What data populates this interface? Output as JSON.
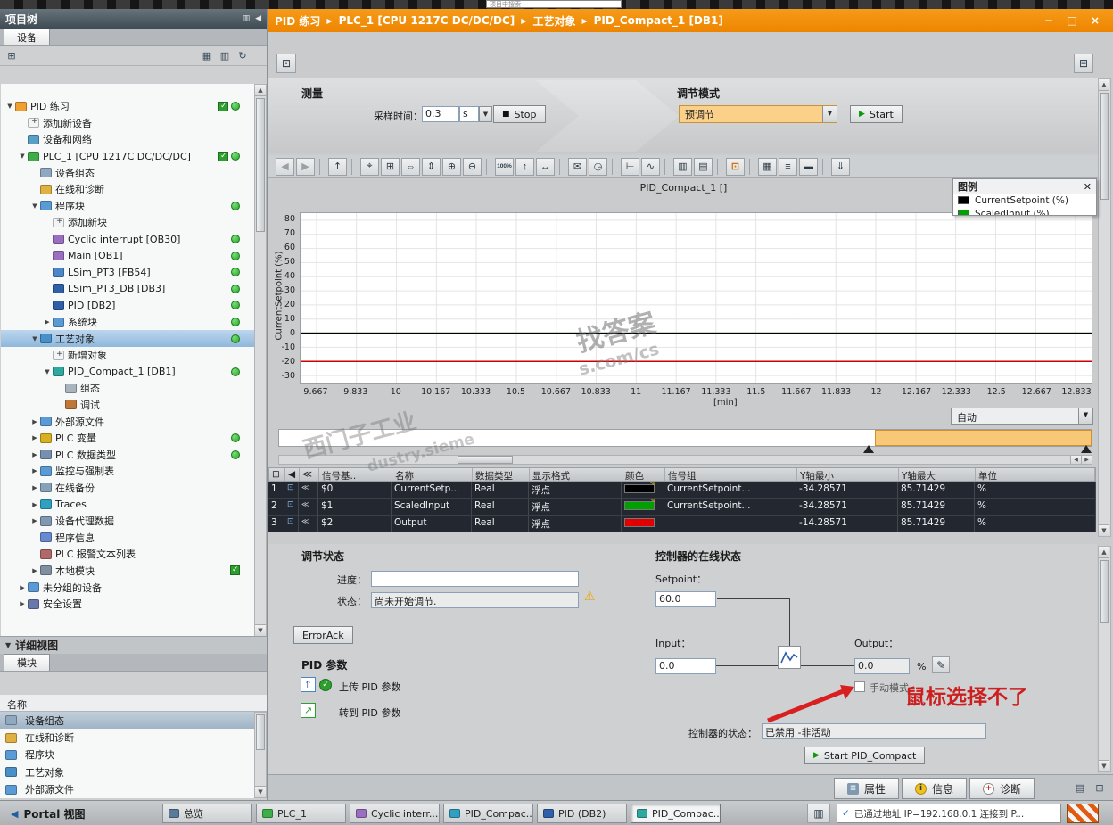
{
  "top_bar": {
    "search_text": "项目中搜索"
  },
  "window": {
    "breadcrumb": [
      "PID 练习",
      "PLC_1 [CPU 1217C DC/DC/DC]",
      "工艺对象",
      "PID_Compact_1 [DB1]"
    ]
  },
  "project_tree": {
    "title": "项目树",
    "tab": "设备",
    "items": [
      {
        "label": "PID 练习",
        "level": 0,
        "arrow": "down",
        "icon": "project-icon",
        "status": [
          "check",
          "dot"
        ]
      },
      {
        "label": "添加新设备",
        "level": 1,
        "icon": "add-device-icon"
      },
      {
        "label": "设备和网络",
        "level": 1,
        "icon": "network-icon"
      },
      {
        "label": "PLC_1 [CPU 1217C DC/DC/DC]",
        "level": 1,
        "arrow": "down",
        "icon": "plc-icon",
        "status": [
          "check",
          "dot"
        ]
      },
      {
        "label": "设备组态",
        "level": 2,
        "icon": "device-config-icon"
      },
      {
        "label": "在线和诊断",
        "level": 2,
        "icon": "online-diag-icon"
      },
      {
        "label": "程序块",
        "level": 2,
        "arrow": "down",
        "icon": "folder-icon",
        "status": [
          "dot"
        ]
      },
      {
        "label": "添加新块",
        "level": 3,
        "icon": "add-block-icon"
      },
      {
        "label": "Cyclic interrupt [OB30]",
        "level": 3,
        "icon": "ob-block-icon",
        "status": [
          "dot"
        ]
      },
      {
        "label": "Main [OB1]",
        "level": 3,
        "icon": "ob-block-icon",
        "status": [
          "dot"
        ]
      },
      {
        "label": "LSim_PT3 [FB54]",
        "level": 3,
        "icon": "fb-block-icon",
        "status": [
          "dot"
        ]
      },
      {
        "label": "LSim_PT3_DB [DB3]",
        "level": 3,
        "icon": "db-block-icon",
        "status": [
          "dot"
        ]
      },
      {
        "label": "PID [DB2]",
        "level": 3,
        "icon": "db-block-icon",
        "status": [
          "dot"
        ]
      },
      {
        "label": "系统块",
        "level": 3,
        "arrow": "right",
        "icon": "folder-icon",
        "status": [
          "dot"
        ]
      },
      {
        "label": "工艺对象",
        "level": 2,
        "arrow": "down",
        "icon": "tech-folder-icon",
        "status": [
          "dot"
        ],
        "selected": true
      },
      {
        "label": "新增对象",
        "level": 3,
        "icon": "add-object-icon"
      },
      {
        "label": "PID_Compact_1 [DB1]",
        "level": 3,
        "arrow": "down",
        "icon": "tech-object-icon",
        "status": [
          "dot"
        ]
      },
      {
        "label": "组态",
        "level": 4,
        "icon": "config-icon"
      },
      {
        "label": "调试",
        "level": 4,
        "icon": "commissioning-icon"
      },
      {
        "label": "外部源文件",
        "level": 2,
        "arrow": "right",
        "icon": "folder-icon"
      },
      {
        "label": "PLC 变量",
        "level": 2,
        "arrow": "right",
        "icon": "tags-icon",
        "status": [
          "dot"
        ]
      },
      {
        "label": "PLC 数据类型",
        "level": 2,
        "arrow": "right",
        "icon": "datatypes-icon",
        "status": [
          "dot"
        ]
      },
      {
        "label": "监控与强制表",
        "level": 2,
        "arrow": "right",
        "icon": "folder-icon"
      },
      {
        "label": "在线备份",
        "level": 2,
        "arrow": "right",
        "icon": "backup-icon"
      },
      {
        "label": "Traces",
        "level": 2,
        "arrow": "right",
        "icon": "traces-icon"
      },
      {
        "label": "设备代理数据",
        "level": 2,
        "arrow": "right",
        "icon": "proxy-icon"
      },
      {
        "label": "程序信息",
        "level": 2,
        "icon": "program-info-icon"
      },
      {
        "label": "PLC 报警文本列表",
        "level": 2,
        "icon": "alarm-text-icon"
      },
      {
        "label": "本地模块",
        "level": 2,
        "arrow": "right",
        "icon": "local-modules-icon",
        "status": [
          "check"
        ]
      },
      {
        "label": "未分组的设备",
        "level": 1,
        "arrow": "right",
        "icon": "folder-icon"
      },
      {
        "label": "安全设置",
        "level": 1,
        "arrow": "right",
        "icon": "security-icon"
      }
    ]
  },
  "detail_view": {
    "title": "详细视图",
    "tab": "模块",
    "column": "名称",
    "items": [
      {
        "label": "设备组态",
        "icon": "device-config-icon",
        "selected": true
      },
      {
        "label": "在线和诊断",
        "icon": "online-diag-icon"
      },
      {
        "label": "程序块",
        "icon": "folder-icon"
      },
      {
        "label": "工艺对象",
        "icon": "tech-folder-icon"
      },
      {
        "label": "外部源文件",
        "icon": "folder-icon"
      }
    ]
  },
  "measurement": {
    "title": "测量",
    "sampling_label": "采样时间：",
    "sampling_value": "0.3",
    "sampling_unit": "s",
    "stop_label": "Stop"
  },
  "tuning": {
    "title": "调节模式",
    "mode": "预调节",
    "start_label": "Start"
  },
  "chart": {
    "title": "PID_Compact_1 []",
    "legend_title": "图例",
    "legend_items": [
      {
        "label": "CurrentSetpoint (%)",
        "color": "#000000"
      },
      {
        "label": "ScaledInput (%)",
        "color": "#00a000"
      }
    ],
    "y_axis_label": "CurrentSetpoint (%)",
    "x_axis_label": "[min]",
    "mode_select": "自动"
  },
  "chart_data": {
    "type": "line",
    "title": "PID_Compact_1 []",
    "xlabel": "[min]",
    "ylabel": "CurrentSetpoint (%)",
    "xlim": [
      9.6,
      12.9
    ],
    "ylim": [
      -35,
      85
    ],
    "xticks": [
      "9.667",
      "9.833",
      "10",
      "10.167",
      "10.333",
      "10.5",
      "10.667",
      "10.833",
      "11",
      "11.167",
      "11.333",
      "11.5",
      "11.667",
      "11.833",
      "12",
      "12.167",
      "12.333",
      "12.5",
      "12.667",
      "12.833"
    ],
    "yticks": [
      80,
      70,
      60,
      50,
      40,
      30,
      20,
      10,
      0,
      -10,
      -20,
      -30
    ],
    "series": [
      {
        "name": "ScaledInput",
        "color": "#00a000",
        "value": 0
      },
      {
        "name": "CurrentSetpoint",
        "color": "#000000",
        "value": 0
      },
      {
        "name": "Output",
        "color": "#cc0000",
        "value": -20
      }
    ],
    "grid": true,
    "legend_position": "top-right"
  },
  "signal_table": {
    "headers": [
      "信号基..",
      "名称",
      "数据类型",
      "显示格式",
      "颜色",
      "信号组",
      "Y轴最小",
      "Y轴最大",
      "单位"
    ],
    "rows": [
      {
        "num": "1",
        "signal": "$0",
        "name": "CurrentSetp...",
        "datatype": "Real",
        "format": "浮点",
        "color": "#000000",
        "pencil": true,
        "group": "CurrentSetpoint...",
        "ymin": "-34.28571",
        "ymax": "85.71429",
        "unit": "%"
      },
      {
        "num": "2",
        "signal": "$1",
        "name": "ScaledInput",
        "datatype": "Real",
        "format": "浮点",
        "color": "#00a000",
        "pencil": true,
        "group": "CurrentSetpoint...",
        "ymin": "-34.28571",
        "ymax": "85.71429",
        "unit": "%"
      },
      {
        "num": "3",
        "signal": "$2",
        "name": "Output",
        "datatype": "Real",
        "format": "浮点",
        "color": "#e00000",
        "pencil": false,
        "group": "",
        "ymin": "-14.28571",
        "ymax": "85.71429",
        "unit": "%"
      }
    ]
  },
  "tuning_status": {
    "title": "调节状态",
    "progress_label": "进度：",
    "progress_value": "",
    "status_label": "状态：",
    "status_value": "尚未开始调节.",
    "error_ack": "ErrorAck"
  },
  "pid_params": {
    "title": "PID 参数",
    "upload": "上传 PID 参数",
    "goto": "转到 PID 参数"
  },
  "online_status": {
    "title": "控制器的在线状态",
    "setpoint_label": "Setpoint：",
    "setpoint": "60.0",
    "input_label": "Input：",
    "input": "0.0",
    "output_label": "Output：",
    "output": "0.0",
    "output_unit": "%",
    "manual_mode": "手动模式",
    "state_label": "控制器的状态：",
    "state": "已禁用 -非活动",
    "start_button": "Start PID_Compact"
  },
  "annotation": {
    "text": "鼠标选择不了",
    "color": "#cc2020"
  },
  "watermarks": [
    "找答案",
    "s.com/cs",
    "西门子工业",
    "dustry.sieme"
  ],
  "chart_toolbar": [
    {
      "name": "back-icon",
      "glyph": "◀",
      "disabled": true
    },
    {
      "name": "forward-icon",
      "glyph": "▶",
      "disabled": true
    },
    {
      "sep": true
    },
    {
      "name": "export-measurement-icon",
      "glyph": "↥"
    },
    {
      "sep": true
    },
    {
      "name": "pointer-icon",
      "glyph": "⌖"
    },
    {
      "name": "zoom-selection-icon",
      "glyph": "⊞"
    },
    {
      "name": "zoom-time-icon",
      "glyph": "⇔"
    },
    {
      "name": "zoom-value-icon",
      "glyph": "⇕"
    },
    {
      "name": "zoom-in-icon",
      "glyph": "⊕"
    },
    {
      "name": "zoom-out-icon",
      "glyph": "⊖"
    },
    {
      "sep": true
    },
    {
      "name": "zoom-100-icon",
      "glyph": "100%",
      "tiny": true
    },
    {
      "name": "fit-value-icon",
      "glyph": "↕"
    },
    {
      "name": "fit-time-icon",
      "glyph": "↔"
    },
    {
      "sep": true
    },
    {
      "name": "envelope-icon",
      "glyph": "✉"
    },
    {
      "name": "timestamp-icon",
      "glyph": "◷"
    },
    {
      "sep": true
    },
    {
      "name": "ruler-icon",
      "glyph": "⊢"
    },
    {
      "name": "trend-view-icon",
      "glyph": "∿"
    },
    {
      "sep": true
    },
    {
      "name": "vertical-grid-icon",
      "glyph": "▥"
    },
    {
      "name": "horizontal-grid-icon",
      "glyph": "▤"
    },
    {
      "sep": true
    },
    {
      "name": "snapshot-icon",
      "glyph": "⊡"
    },
    {
      "sep": true
    },
    {
      "name": "table-view-icon",
      "glyph": "▦"
    },
    {
      "name": "align-left-icon",
      "glyph": "≡"
    },
    {
      "name": "align-block-icon",
      "glyph": "▬"
    },
    {
      "sep": true
    },
    {
      "name": "save-measurement-icon",
      "glyph": "⇓"
    }
  ],
  "props_tabs": [
    {
      "label": "属性",
      "icon": "properties-icon"
    },
    {
      "label": "信息",
      "icon": "info-icon"
    },
    {
      "label": "诊断",
      "icon": "diagnostics-icon"
    }
  ],
  "taskbar": {
    "portal": "Portal 视图",
    "buttons": [
      {
        "label": "总览",
        "icon": "overview-icon"
      },
      {
        "label": "PLC_1",
        "icon": "plc-icon"
      },
      {
        "label": "Cyclic interr...",
        "icon": "ob-block-icon"
      },
      {
        "label": "PID_Compac...",
        "icon": "trace-icon"
      },
      {
        "label": "PID (DB2)",
        "icon": "db-block-icon"
      },
      {
        "label": "PID_Compac...",
        "icon": "tech-object-icon",
        "active": true
      }
    ],
    "status_check": "✓",
    "status": "已通过地址 IP=192.168.0.1 连接到 P..."
  }
}
